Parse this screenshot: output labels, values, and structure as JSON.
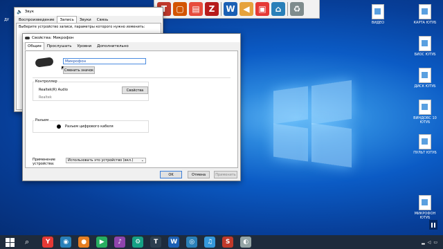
{
  "desktop_icons": [
    {
      "label": "ВИДЕО"
    },
    {
      "label": "КАРТА ЮТУБ"
    },
    {
      "label": "БИОС ЮТУБ"
    },
    {
      "label": "ДИСК ЮТУБ"
    },
    {
      "label": "ВИНДОВС 10 ЮТУБ"
    },
    {
      "label": "ПУЛЬТ ЮТУБ"
    },
    {
      "label": "МИКРОФОН ЮТУБ"
    }
  ],
  "left_edge_label": "ДУ",
  "sound_window": {
    "title": "Звук",
    "tabs": [
      "Воспроизведение",
      "Запись",
      "Звуки",
      "Связь"
    ],
    "instruction": "Выберите устройство записи, параметры которого нужно изменить:"
  },
  "props_window": {
    "title": "Свойства: Микрофон",
    "tabs": [
      "Общие",
      "Прослушать",
      "Уровни",
      "Дополнительно"
    ],
    "name_value": "Микрофон",
    "change_icon_button": "Сменить значок",
    "controller_label": "Контроллер",
    "controller_name": "Realtek(R) Audio",
    "controller_vendor": "Realtek",
    "properties_button": "Свойства",
    "jack_label": "Разъем",
    "jack_text": "Разъем цифрового кабеля",
    "usage_label": "Применение устройства:",
    "usage_value": "Использовать это устройство (вкл.)",
    "ok_button": "OK",
    "cancel_button": "Отмена",
    "apply_button": "Применить"
  },
  "quick_launch": [
    {
      "icon": "text-editor-icon",
      "color": "#c0392b",
      "glyph": "T"
    },
    {
      "icon": "screen-capture-icon",
      "color": "#d35400",
      "glyph": "▢"
    },
    {
      "icon": "book-icon",
      "color": "#e74c3c",
      "glyph": "▤"
    },
    {
      "icon": "filezilla-icon",
      "color": "#b71c1c",
      "glyph": "Z"
    },
    {
      "icon": "word-icon",
      "color": "#1a5fb4",
      "glyph": "W"
    },
    {
      "icon": "megaphone-icon",
      "color": "#e6a23c",
      "glyph": "◀"
    },
    {
      "icon": "bag-icon",
      "color": "#e53935",
      "glyph": "▣"
    },
    {
      "icon": "pin-icon",
      "color": "#2980b9",
      "glyph": "⌂"
    },
    {
      "icon": "recycle-bin-icon",
      "color": "#7f8c8d",
      "glyph": "♻"
    }
  ],
  "taskbar": {
    "icons": [
      {
        "icon": "yandex-browser-icon",
        "color": "#e53935",
        "glyph": "Y"
      },
      {
        "icon": "app-icon",
        "color": "#2980b9",
        "glyph": "◉"
      },
      {
        "icon": "firefox-icon",
        "color": "#e67e22",
        "glyph": "●"
      },
      {
        "icon": "video-icon",
        "color": "#27ae60",
        "glyph": "▶"
      },
      {
        "icon": "media-icon",
        "color": "#8e44ad",
        "glyph": "♪"
      },
      {
        "icon": "settings-icon",
        "color": "#16a085",
        "glyph": "⚙"
      },
      {
        "icon": "app-t-icon",
        "color": "#2c3e50",
        "glyph": "T"
      },
      {
        "icon": "word-icon",
        "color": "#1a5fb4",
        "glyph": "W"
      },
      {
        "icon": "camera-icon",
        "color": "#2980b9",
        "glyph": "◎"
      },
      {
        "icon": "music-icon",
        "color": "#3498db",
        "glyph": "♫"
      },
      {
        "icon": "sound-icon",
        "color": "#c0392b",
        "glyph": "S"
      },
      {
        "icon": "explorer-icon",
        "color": "#95a5a6",
        "glyph": "◐"
      }
    ]
  }
}
